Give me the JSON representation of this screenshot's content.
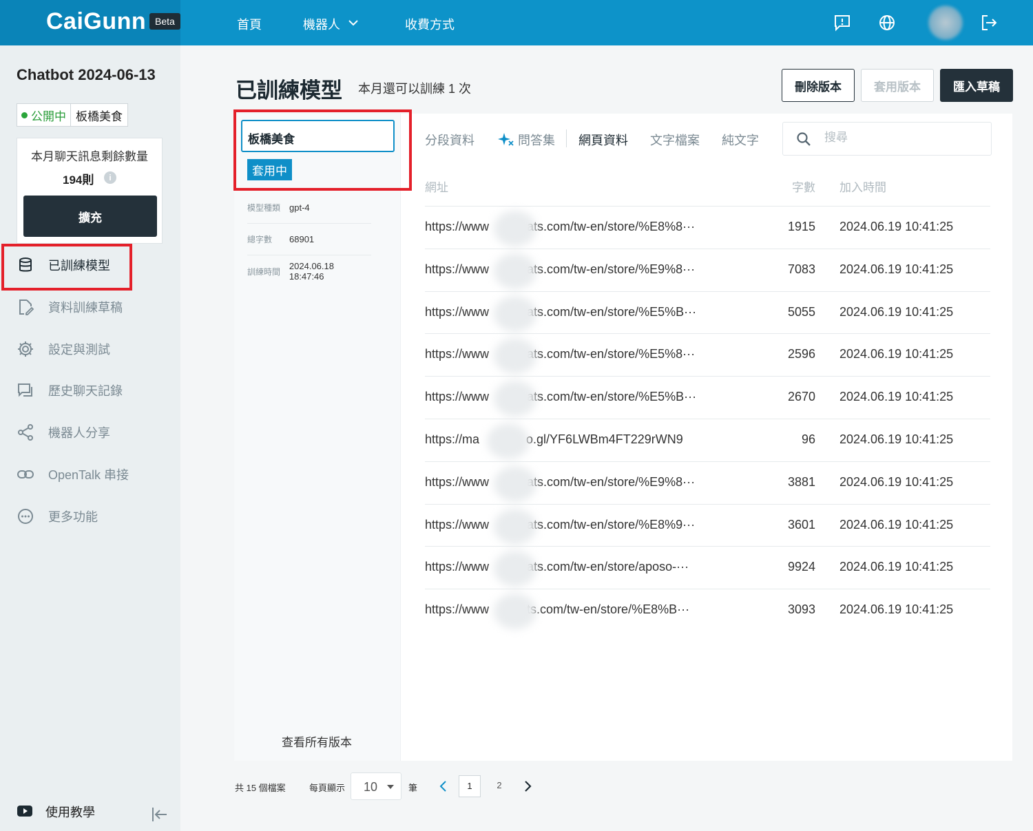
{
  "brand": {
    "name": "CaiGunn",
    "badge": "Beta"
  },
  "nav": {
    "home": "首頁",
    "robots": "機器人",
    "pricing": "收費方式"
  },
  "sidebar": {
    "bot_title": "Chatbot 2024-06-13",
    "status": "公開中",
    "bot_name": "板橋美食",
    "quota_label": "本月聊天訊息剩餘數量",
    "quota_value": "194則",
    "expand_label": "擴充",
    "items": [
      {
        "label": "已訓練模型",
        "icon": "database-icon"
      },
      {
        "label": "資料訓練草稿",
        "icon": "draft-edit-icon"
      },
      {
        "label": "設定與測試",
        "icon": "gear-icon"
      },
      {
        "label": "歷史聊天記錄",
        "icon": "chat-history-icon"
      },
      {
        "label": "機器人分享",
        "icon": "share-icon"
      },
      {
        "label": "OpenTalk 串接",
        "icon": "link-icon"
      },
      {
        "label": "更多功能",
        "icon": "more-icon"
      }
    ],
    "tutorial": "使用教學"
  },
  "header": {
    "title": "已訓練模型",
    "subtitle": "本月還可以訓練 1 次",
    "delete_label": "刪除版本",
    "apply_label": "套用版本",
    "import_label": "匯入草稿"
  },
  "version": {
    "name": "板橋美食",
    "status_tag": "套用中",
    "meta": [
      {
        "key": "模型種類",
        "value": "gpt-4"
      },
      {
        "key": "總字數",
        "value": "68901"
      },
      {
        "key": "訓練時間",
        "value": "2024.06.18 18:47:46"
      }
    ],
    "see_all": "查看所有版本"
  },
  "tabs": [
    "分段資料",
    "問答集",
    "網頁資料",
    "文字檔案",
    "純文字"
  ],
  "active_tab": "網頁資料",
  "search": {
    "placeholder": "搜尋"
  },
  "table": {
    "headers": {
      "url": "網址",
      "count": "字數",
      "time": "加入時間"
    },
    "rows": [
      {
        "url_start": "https://www",
        "url_end": "ats.com/tw-en/store/%E8%8···",
        "count": "1915",
        "time": "2024.06.19 10:41:25"
      },
      {
        "url_start": "https://www",
        "url_end": "ats.com/tw-en/store/%E9%8···",
        "count": "7083",
        "time": "2024.06.19 10:41:25"
      },
      {
        "url_start": "https://www",
        "url_end": "ats.com/tw-en/store/%E5%B···",
        "count": "5055",
        "time": "2024.06.19 10:41:25"
      },
      {
        "url_start": "https://www",
        "url_end": "ats.com/tw-en/store/%E5%8···",
        "count": "2596",
        "time": "2024.06.19 10:41:25"
      },
      {
        "url_start": "https://www",
        "url_end": "ats.com/tw-en/store/%E5%B···",
        "count": "2670",
        "time": "2024.06.19 10:41:25"
      },
      {
        "url_start": "https://ma",
        "url_end": "o.gl/YF6LWBm4FT229rWN9",
        "count": "96",
        "time": "2024.06.19 10:41:25"
      },
      {
        "url_start": "https://www",
        "url_end": "ats.com/tw-en/store/%E9%8···",
        "count": "3881",
        "time": "2024.06.19 10:41:25"
      },
      {
        "url_start": "https://www",
        "url_end": "ats.com/tw-en/store/%E8%9···",
        "count": "3601",
        "time": "2024.06.19 10:41:25"
      },
      {
        "url_start": "https://www",
        "url_end": "ats.com/tw-en/store/aposo-···",
        "count": "9924",
        "time": "2024.06.19 10:41:25"
      },
      {
        "url_start": "https://www",
        "url_end": "ts.com/tw-en/store/%E8%B···",
        "count": "3093",
        "time": "2024.06.19 10:41:25"
      }
    ]
  },
  "pagination": {
    "total": "共 15 個檔案",
    "per_page_label": "每頁顯示",
    "per_page_value": "10",
    "unit": "筆",
    "pages": [
      "1",
      "2"
    ],
    "current_page": "1"
  },
  "colors": {
    "topbar": "#0d93c9",
    "accent": "#0f8fc8",
    "dark": "#24313a",
    "highlight": "#e4202a",
    "status_green": "#2aa53a"
  }
}
